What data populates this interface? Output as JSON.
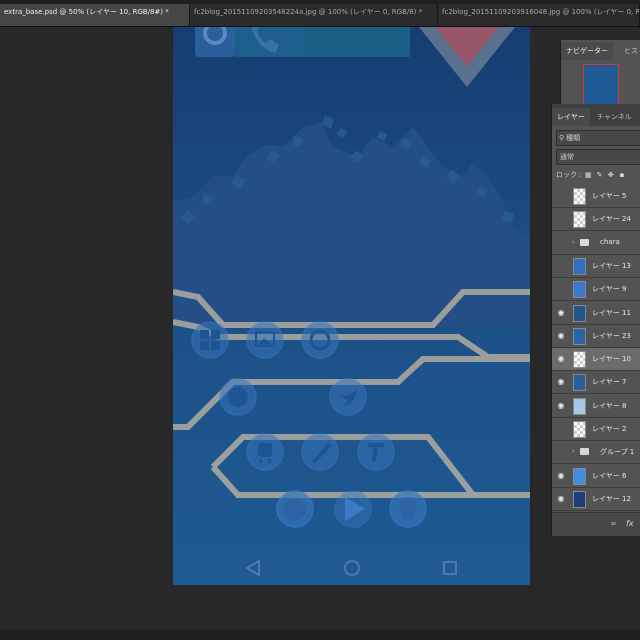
{
  "tabs": [
    {
      "label": "extra_base.psd @ 50% (レイヤー 10, RGB/8#) *",
      "active": true
    },
    {
      "label": "fc2blog_20151109203548224a.jpg @ 100% (レイヤー 0, RGB/8) *",
      "active": false
    },
    {
      "label": "fc2blog_20151109203916048.jpg @ 100% (レイヤー 0, RGB/8) *",
      "active": false
    }
  ],
  "navigator": {
    "tabs": [
      "ナビゲーター",
      "ヒス"
    ]
  },
  "layers_panel": {
    "tabs": [
      "レイヤー",
      "チャンネル"
    ],
    "filter_label": "種類",
    "blend_mode": "通常",
    "lock_label": "ロック :",
    "lock_icons": [
      "transparency-lock-icon",
      "brush-lock-icon",
      "move-lock-icon",
      "all-lock-icon"
    ],
    "fx_label": "fx",
    "layers": [
      {
        "name": "レイヤー 5",
        "visible": false,
        "type": "layer",
        "thumb": "checker"
      },
      {
        "name": "レイヤー 24",
        "visible": false,
        "type": "layer",
        "thumb": "checker"
      },
      {
        "name": "chara",
        "visible": false,
        "type": "folder"
      },
      {
        "name": "レイヤー 13",
        "visible": false,
        "type": "layer",
        "thumb": "#2f6fbf"
      },
      {
        "name": "レイヤー 9",
        "visible": false,
        "type": "layer",
        "thumb": "#3b79d0"
      },
      {
        "name": "レイヤー 11",
        "visible": true,
        "type": "layer",
        "thumb": "#24568e"
      },
      {
        "name": "レイヤー 23",
        "visible": true,
        "type": "layer",
        "thumb": "#2a64a8"
      },
      {
        "name": "レイヤー 10",
        "visible": true,
        "type": "layer",
        "thumb": "checker",
        "selected": true
      },
      {
        "name": "レイヤー 7",
        "visible": true,
        "type": "layer",
        "thumb": "#2b5f9c"
      },
      {
        "name": "レイヤー 8",
        "visible": true,
        "type": "layer",
        "thumb": "#a8c7e6"
      },
      {
        "name": "レイヤー 2",
        "visible": false,
        "type": "layer",
        "thumb": "checker"
      },
      {
        "name": "グループ 1",
        "visible": false,
        "type": "folder"
      },
      {
        "name": "レイヤー 6",
        "visible": true,
        "type": "layer",
        "thumb": "#3d8ee0"
      },
      {
        "name": "レイヤー 12",
        "visible": true,
        "type": "layer",
        "thumb": "#1f3f7a"
      }
    ]
  },
  "phone": {
    "top_icons": [
      "camera-icon",
      "phone-icon",
      "mail-icon"
    ],
    "app_icons": [
      "calculator-icon",
      "gallery-icon",
      "browser-icon",
      "firefox-icon",
      "twitter-icon",
      "train-icon",
      "pen-icon",
      "text-icon",
      "chat-icon",
      "play-icon",
      "chef-icon"
    ],
    "nav_icons": [
      "back-icon",
      "home-icon",
      "recents-icon"
    ]
  },
  "colors": {
    "canvas_bg": "#1f5a93",
    "circuit_line": "#a9a79f",
    "workspace": "#282828",
    "panel": "#535353"
  }
}
